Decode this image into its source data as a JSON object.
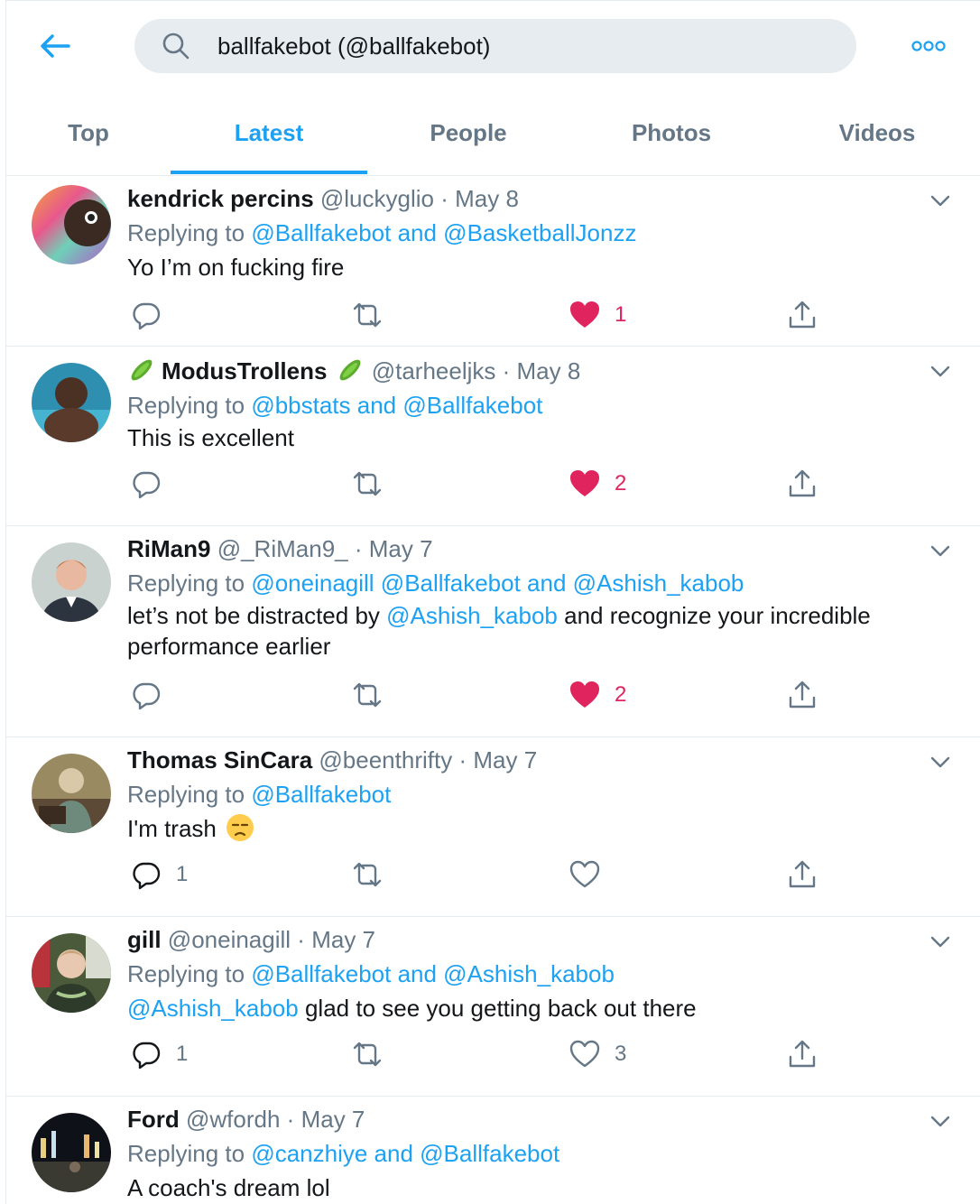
{
  "search": {
    "query": "ballfakebot (@ballfakebot)"
  },
  "tabs": [
    {
      "label": "Top"
    },
    {
      "label": "Latest"
    },
    {
      "label": "People"
    },
    {
      "label": "Photos"
    },
    {
      "label": "Videos"
    }
  ],
  "colors": {
    "accent": "#1da1f2",
    "like": "#e0245e",
    "muted": "#657786",
    "divider": "#e6ecf0"
  },
  "tweets": [
    {
      "name": "kendrick percins",
      "handle": "@luckyglio",
      "sep": "·",
      "date": "May 8",
      "replying_prefix": "Replying to",
      "replying_to": "@Ballfakebot and @BasketballJonzz",
      "text": "Yo I’m on fucking fire",
      "replies": "",
      "likes": "1",
      "liked": true
    },
    {
      "name": "ModusTrollens",
      "name_emoji": "cucumber-emoji",
      "handle": "@tarheeljks",
      "sep": "·",
      "date": "May 8",
      "replying_prefix": "Replying to",
      "replying_to": "@bbstats and @Ballfakebot",
      "text": "This is excellent",
      "replies": "",
      "likes": "2",
      "liked": true
    },
    {
      "name": "RiMan9",
      "handle": "@_RiMan9_",
      "sep": "·",
      "date": "May 7",
      "replying_prefix": "Replying to",
      "replying_to": "@oneinagill @Ballfakebot and @Ashish_kabob",
      "text_pre": "let’s not be distracted by",
      "text_mention": "@Ashish_kabob",
      "text_post": "and recognize your incredible",
      "text_line2": "performance earlier",
      "replies": "",
      "likes": "2",
      "liked": true
    },
    {
      "name": "Thomas SinCara",
      "handle": "@beenthrifty",
      "sep": "·",
      "date": "May 7",
      "replying_prefix": "Replying to",
      "replying_to": "@Ballfakebot",
      "text": "I'm trash",
      "text_emoji": "unamused-face-emoji",
      "replies": "1",
      "likes": "",
      "liked": false
    },
    {
      "name": "gill",
      "handle": "@oneinagill",
      "sep": "·",
      "date": "May 7",
      "replying_prefix": "Replying to",
      "replying_to": "@Ballfakebot and @Ashish_kabob",
      "text_mention": "@Ashish_kabob",
      "text_post": "glad to see you getting back out there",
      "replies": "1",
      "likes": "3",
      "liked": false
    },
    {
      "name": "Ford",
      "handle": "@wfordh",
      "sep": "·",
      "date": "May 7",
      "replying_prefix": "Replying to",
      "replying_to": "@canzhiye and @Ballfakebot",
      "text": "A coach's dream lol"
    }
  ]
}
